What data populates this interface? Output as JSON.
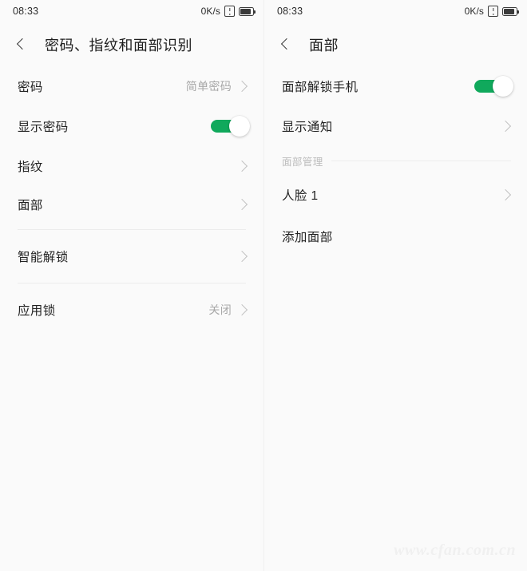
{
  "colors": {
    "accent_green": "#10a95c",
    "page_background": "#fafafa",
    "primary_text": "#222222",
    "secondary_text": "#a8a8a8",
    "divider": "#ececec"
  },
  "left_screen": {
    "status_bar": {
      "time": "08:33",
      "network_speed": "0K/s",
      "signal_icon": "sim-warning-icon",
      "battery_icon": "battery-icon"
    },
    "app_bar": {
      "back_icon": "back-chevron-icon",
      "title": "密码、指纹和面部识别"
    },
    "groups": [
      {
        "rows": [
          {
            "label": "密码",
            "value": "简单密码",
            "control": "chevron"
          },
          {
            "label": "显示密码",
            "value": "",
            "control": "toggle-on"
          },
          {
            "label": "指纹",
            "value": "",
            "control": "chevron"
          },
          {
            "label": "面部",
            "value": "",
            "control": "chevron"
          }
        ]
      },
      {
        "rows": [
          {
            "label": "智能解锁",
            "value": "",
            "control": "chevron"
          }
        ]
      },
      {
        "rows": [
          {
            "label": "应用锁",
            "value": "关闭",
            "control": "chevron"
          }
        ]
      }
    ]
  },
  "right_screen": {
    "status_bar": {
      "time": "08:33",
      "network_speed": "0K/s",
      "signal_icon": "sim-warning-icon",
      "battery_icon": "battery-icon"
    },
    "app_bar": {
      "back_icon": "back-chevron-icon",
      "title": "面部"
    },
    "rows": [
      {
        "label": "面部解锁手机",
        "value": "",
        "control": "toggle-on"
      },
      {
        "label": "显示通知",
        "value": "",
        "control": "chevron"
      }
    ],
    "section": {
      "header": "面部管理",
      "rows": [
        {
          "label": "人脸 1",
          "value": "",
          "control": "chevron"
        },
        {
          "label": "添加面部",
          "value": "",
          "control": "none"
        }
      ]
    }
  },
  "watermark": "www.cfan.com.cn"
}
